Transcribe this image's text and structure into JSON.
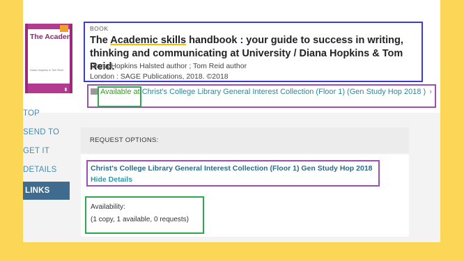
{
  "cover": {
    "title": "The Academic Skills Handbook",
    "authors": "Diana Hopkins & Tom Reid"
  },
  "nav": {
    "items": [
      {
        "label": "TOP"
      },
      {
        "label": "SEND TO"
      },
      {
        "label": "GET IT"
      },
      {
        "label": "DETAILS"
      },
      {
        "label": "LINKS"
      }
    ],
    "active": "LINKS"
  },
  "record": {
    "type": "BOOK",
    "title_pre": "The ",
    "title_highlight": "Academic skills",
    "title_post": " handbook : your guide to success in writing, thinking and communicating at University / Diana Hopkins & Tom Reid.",
    "authors": "Diana Hopkins Halsted author ; Tom Reid author",
    "publisher": "London : SAGE Publications, 2018. ©2018"
  },
  "availability_row": {
    "status": "Available at",
    "location": " Christ's College Library  General Interest Collection (Floor 1) (Gen Study Hop 2018 )",
    "chevron": "›"
  },
  "request": {
    "label": "REQUEST OPTIONS:"
  },
  "holding": {
    "location": "Christ's College Library   General Interest Collection (Floor 1)   Gen Study Hop 2018",
    "hide_details": "Hide Details",
    "availability_label": "Availability:",
    "copies": "(1 copy, 1 available, 0 requests)"
  },
  "colors": {
    "background": "#fcd757",
    "nav_active": "#3e6b8e",
    "link": "#2a8a9a",
    "available": "#3a9a2a",
    "annotation_blue": "#3b3bd0",
    "annotation_purple": "#9b4fb0",
    "annotation_green": "#2aa84a"
  }
}
